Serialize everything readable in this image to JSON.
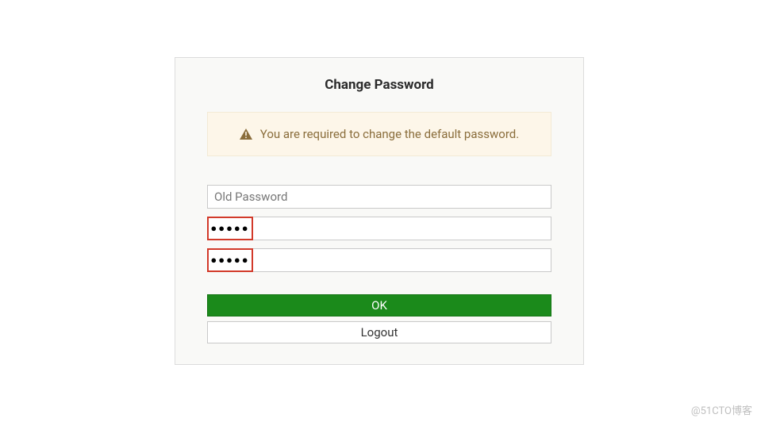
{
  "panel": {
    "title": "Change Password"
  },
  "alert": {
    "icon": "warning-triangle",
    "message": "You are required to change the default password."
  },
  "fields": {
    "old_password": {
      "placeholder": "Old Password",
      "value": ""
    },
    "new_password": {
      "mask": "●●●●●",
      "value": ""
    },
    "confirm_password": {
      "mask": "●●●●●",
      "value": ""
    }
  },
  "buttons": {
    "ok": "OK",
    "logout": "Logout"
  },
  "watermark": "@51CTO博客"
}
